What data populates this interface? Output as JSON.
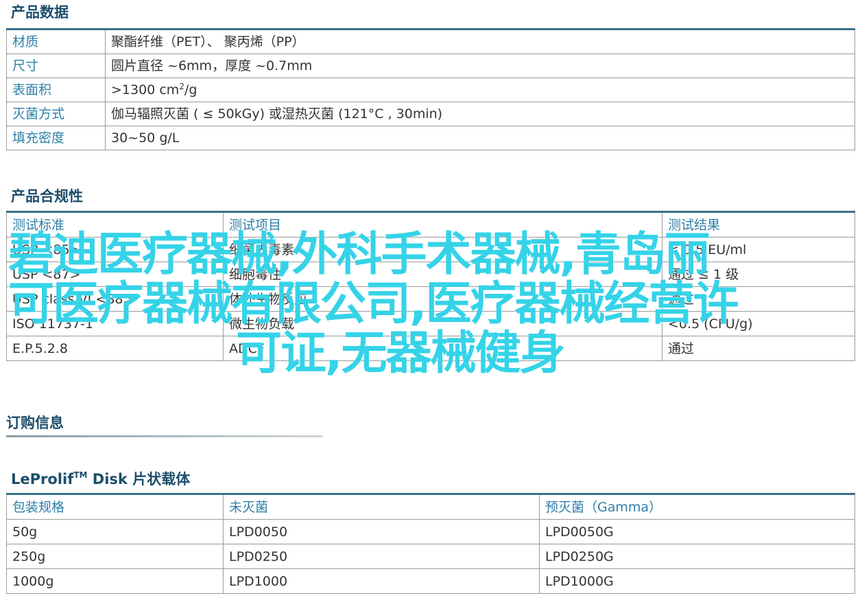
{
  "product_data": {
    "title": "产品数据",
    "rows": [
      {
        "key": "材质",
        "value": "聚酯纤维（PET）、 聚丙烯（PP）"
      },
      {
        "key": "尺寸",
        "value": "圆片直径 ~6mm，厚度 ~0.7mm"
      },
      {
        "key": "表面积",
        "value_prefix": ">1300 cm",
        "value_sup": "2",
        "value_suffix": "/g"
      },
      {
        "key": "灭菌方式",
        "value": "伽马辐照灭菌 ( ≤ 50kGy) 或湿热灭菌 (121°C , 30min)"
      },
      {
        "key": "填充密度",
        "value": "30~50 g/L"
      }
    ]
  },
  "compliance": {
    "title": "产品合规性",
    "headers": [
      "测试标准",
      "测试项目",
      "测试结果"
    ],
    "rows": [
      [
        "USP <85>",
        "细菌内毒素",
        "< 0.5 EU/ml"
      ],
      [
        "USP <87>",
        "细胞毒性",
        "通过 ≤ 1 级"
      ],
      [
        "USP class VI <88>",
        "体外生物反应",
        "通过"
      ],
      [
        "ISO 11737-1",
        "微生物负载",
        "<0.5 (CFU/g)"
      ],
      [
        "E.P.5.2.8",
        "ADCF",
        "通过"
      ]
    ]
  },
  "order_info": {
    "title": "订购信息"
  },
  "leprolif": {
    "title_prefix": "LeProlif",
    "title_tm": "TM",
    "title_suffix": " Disk 片状载体",
    "headers": [
      "包装规格",
      "未灭菌",
      "预灭菌（Gamma）"
    ],
    "rows": [
      [
        "50g",
        "LPD0050",
        "LPD0050G"
      ],
      [
        "250g",
        "LPD0250",
        "LPD0250G"
      ],
      [
        "1000g",
        "LPD1000",
        "LPD1000G"
      ]
    ]
  },
  "overlay": {
    "line1": "碧迪医疗器械,外科手术器械,青岛丽",
    "line2": "可医疗器械有限公司,医疗器械经营许",
    "line3": "可证,无器械健身"
  },
  "colors": {
    "title": "#1d4e6b",
    "key_text": "#2e7fa9",
    "table_top_border": "#3a6f8c",
    "overlay_text": "#35d3e8"
  }
}
